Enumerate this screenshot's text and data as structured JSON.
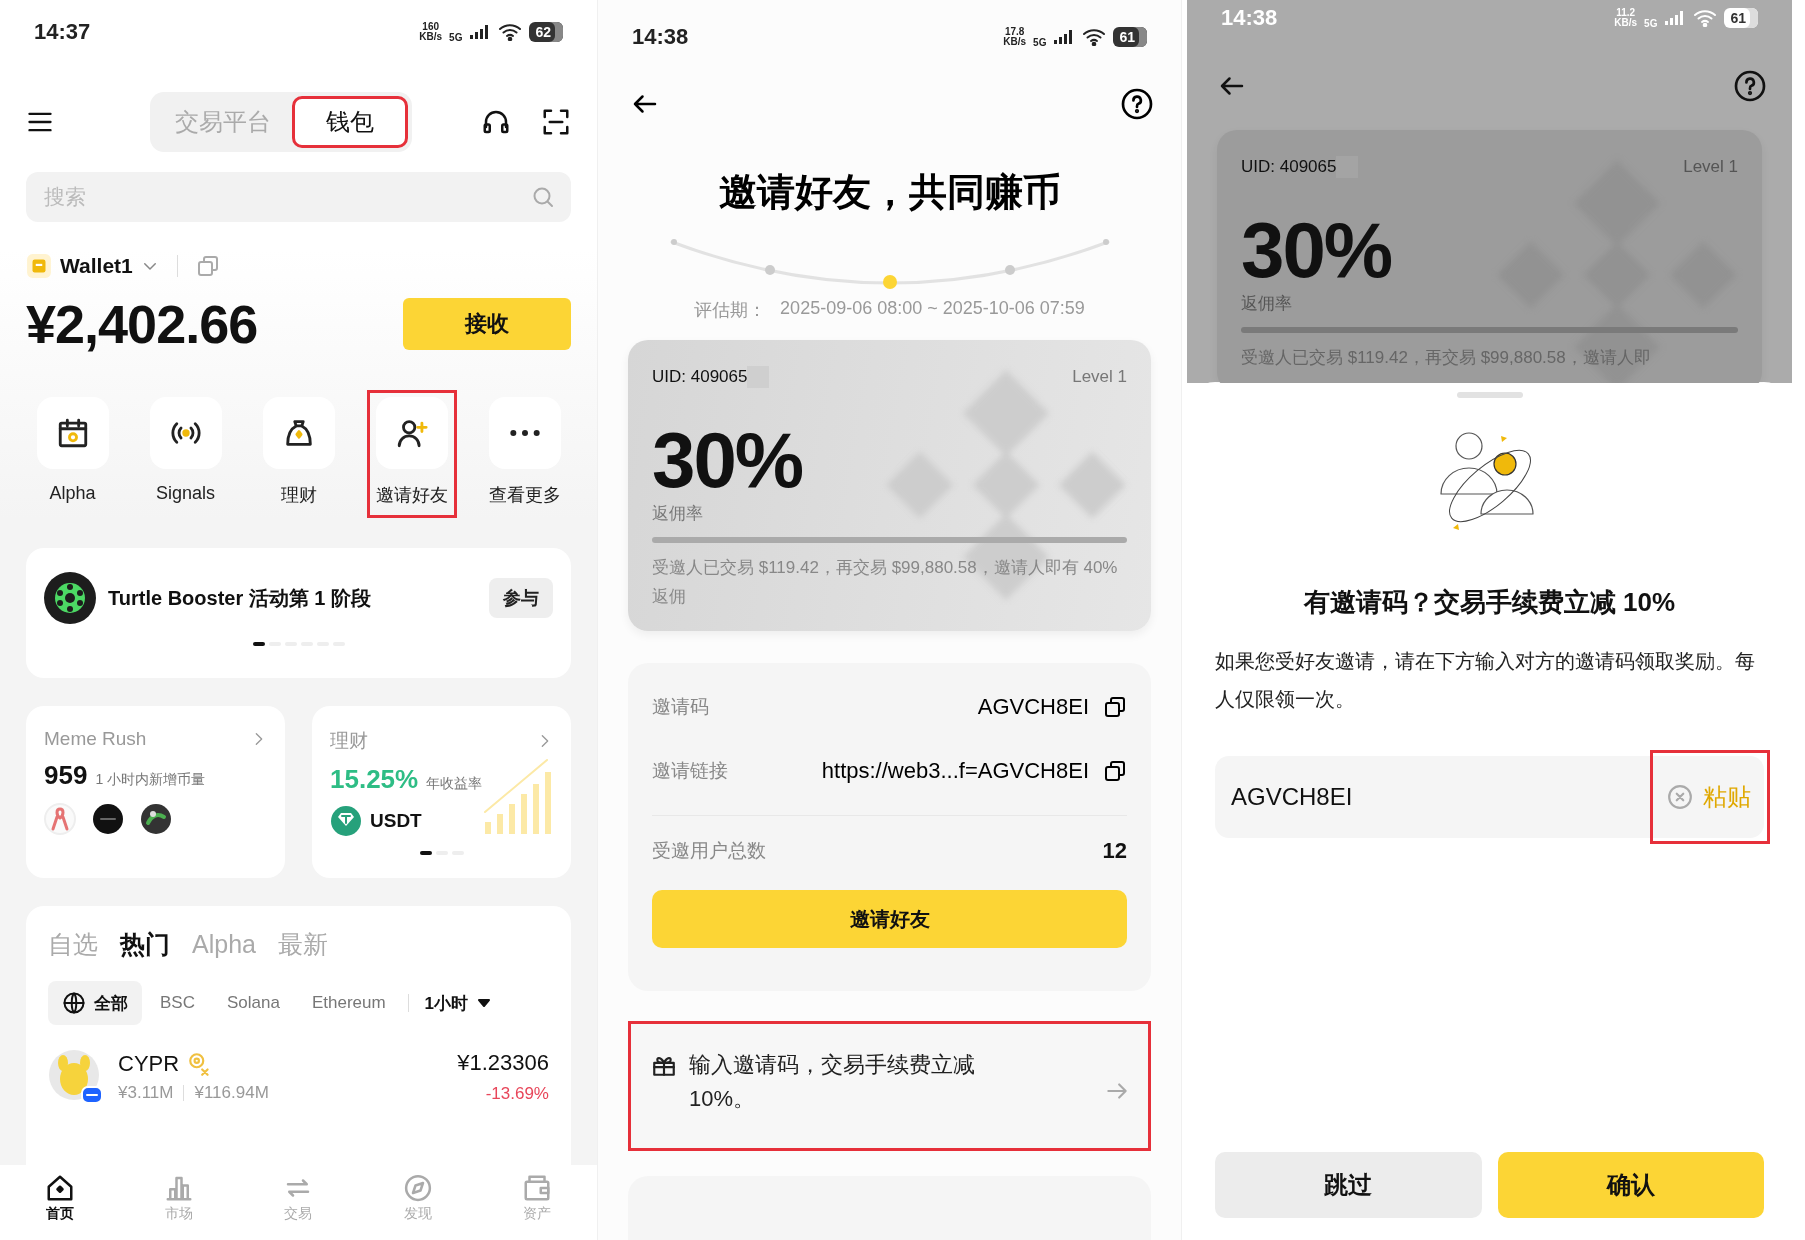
{
  "home": {
    "status_bar": {
      "time": "14:37",
      "speed": "160",
      "speed_unit": "KB/s",
      "network": "5G",
      "battery": "62"
    },
    "tabs": [
      {
        "label": "交易平台",
        "selected": false,
        "highlighted": false
      },
      {
        "label": "钱包",
        "selected": true,
        "highlighted": true
      }
    ],
    "search": {
      "placeholder": "搜索"
    },
    "wallet": {
      "name": "Wallet1",
      "balance": "¥2,402.66",
      "receive_button": "接收"
    },
    "shortcuts": [
      {
        "label": "Alpha",
        "highlighted": false
      },
      {
        "label": "Signals",
        "highlighted": false
      },
      {
        "label": "理财",
        "highlighted": false
      },
      {
        "label": "邀请好友",
        "highlighted": true
      },
      {
        "label": "查看更多",
        "highlighted": false
      }
    ],
    "banner": {
      "title": "Turtle Booster 活动第 1 阶段",
      "button": "参与",
      "pager": [
        {
          "selected": true
        },
        {
          "selected": false
        },
        {
          "selected": false
        },
        {
          "selected": false
        },
        {
          "selected": false
        },
        {
          "selected": false
        }
      ]
    },
    "meme_card": {
      "title": "Meme Rush",
      "count": "959",
      "caption": "1 小时内新增币量"
    },
    "earn_card": {
      "title": "理财",
      "rate": "15.25%",
      "caption": "年收益率",
      "token": "USDT",
      "pager": [
        {
          "selected": true
        },
        {
          "selected": false
        },
        {
          "selected": false
        }
      ]
    },
    "market": {
      "tabs": [
        {
          "label": "自选",
          "selected": false
        },
        {
          "label": "热门",
          "selected": true
        },
        {
          "label": "Alpha",
          "selected": false
        },
        {
          "label": "最新",
          "selected": false
        }
      ],
      "filters": [
        {
          "label": "全部",
          "selected": true
        },
        {
          "label": "BSC",
          "selected": false
        },
        {
          "label": "Solana",
          "selected": false
        },
        {
          "label": "Ethereum",
          "selected": false
        }
      ],
      "timeframe": "1小时",
      "rows": [
        {
          "symbol": "CYPR",
          "volume": "¥3.11M",
          "market_cap": "¥116.94M",
          "price": "¥1.23306",
          "change": "-13.69%",
          "falling": true
        }
      ]
    },
    "nav": [
      {
        "label": "首页",
        "selected": true
      },
      {
        "label": "市场",
        "selected": false
      },
      {
        "label": "交易",
        "selected": false
      },
      {
        "label": "发现",
        "selected": false
      },
      {
        "label": "资产",
        "selected": false
      }
    ]
  },
  "invite": {
    "status_bar": {
      "time": "14:38",
      "speed": "17.8",
      "speed_unit": "KB/s",
      "network": "5G",
      "battery": "61"
    },
    "title": "邀请好友，共同赚币",
    "period_label": "评估期：",
    "period": "2025-09-06 08:00 ~ 2025-10-06 07:59",
    "card": {
      "uid": "UID: 409065",
      "tier": "Level 1",
      "rate": "30%",
      "rate_label": "返佣率",
      "note": "受邀人已交易 $119.42，再交易 $99,880.58，邀请人即有 40% 返佣"
    },
    "links": [
      {
        "label": "邀请码",
        "value": "AGVCH8EI"
      },
      {
        "label": "邀请链接",
        "value": "https://web3...f=AGVCH8EI"
      }
    ],
    "total": {
      "label": "受邀用户总数",
      "value": "12"
    },
    "invite_button": "邀请好友",
    "promo": {
      "text": "输入邀请码，交易手续费立减 10%。",
      "highlighted": true
    }
  },
  "code_sheet": {
    "status_bar": {
      "time": "14:38",
      "speed": "11.2",
      "speed_unit": "KB/s",
      "network": "5G",
      "battery": "61"
    },
    "card": {
      "uid": "UID: 409065",
      "tier": "Level 1",
      "rate": "30%",
      "rate_label": "返佣率",
      "note": "受邀人已交易 $119.42，再交易 $99,880.58，邀请人即"
    },
    "title": "有邀请码？交易手续费立减 10%",
    "description": "如果您受好友邀请，请在下方输入对方的邀请码领取奖励。每人仅限领一次。",
    "code_field": {
      "value": "AGVCH8EI"
    },
    "paste": {
      "label": "粘贴",
      "highlighted": true
    },
    "buttons": [
      {
        "label": "跳过",
        "kind": "secondary"
      },
      {
        "label": "确认",
        "kind": "primary"
      }
    ]
  }
}
